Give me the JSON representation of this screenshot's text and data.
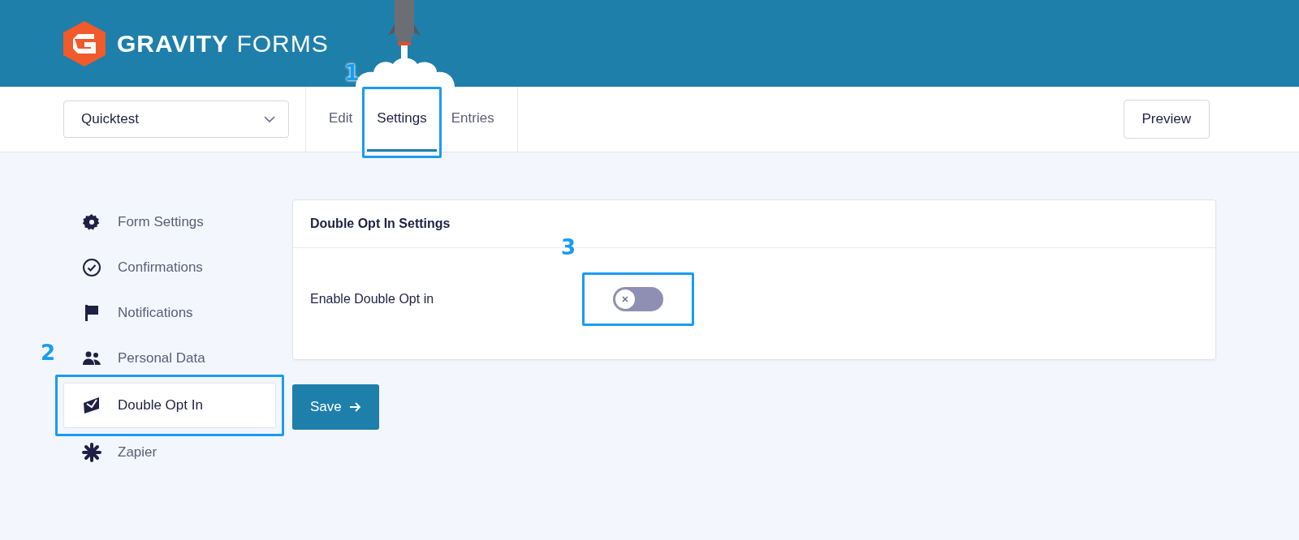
{
  "header": {
    "logo_text": "**GRAVITY** FORMS"
  },
  "toolbar": {
    "form_select": {
      "value": "Quicktest"
    },
    "tabs": [
      {
        "label": "Edit",
        "selected": false
      },
      {
        "label": "Settings",
        "selected": true,
        "callout": "1"
      },
      {
        "label": "Entries",
        "selected": false
      }
    ],
    "preview_button": "Preview"
  },
  "sidebar": {
    "items": [
      {
        "label": "Form Settings",
        "selected": false
      },
      {
        "label": "Confirmations",
        "selected": false
      },
      {
        "label": "Notifications",
        "selected": false
      },
      {
        "label": "Personal Data",
        "selected": false
      },
      {
        "label": "Double Opt In",
        "selected": true,
        "callout": "2"
      },
      {
        "label": "Zapier",
        "selected": false
      }
    ]
  },
  "panel": {
    "title": "Double Opt In Settings",
    "fields": [
      {
        "label": "Enable Double Opt in",
        "kind": "toggle",
        "on": false,
        "callout": "3"
      }
    ]
  },
  "save_button": "Save"
}
